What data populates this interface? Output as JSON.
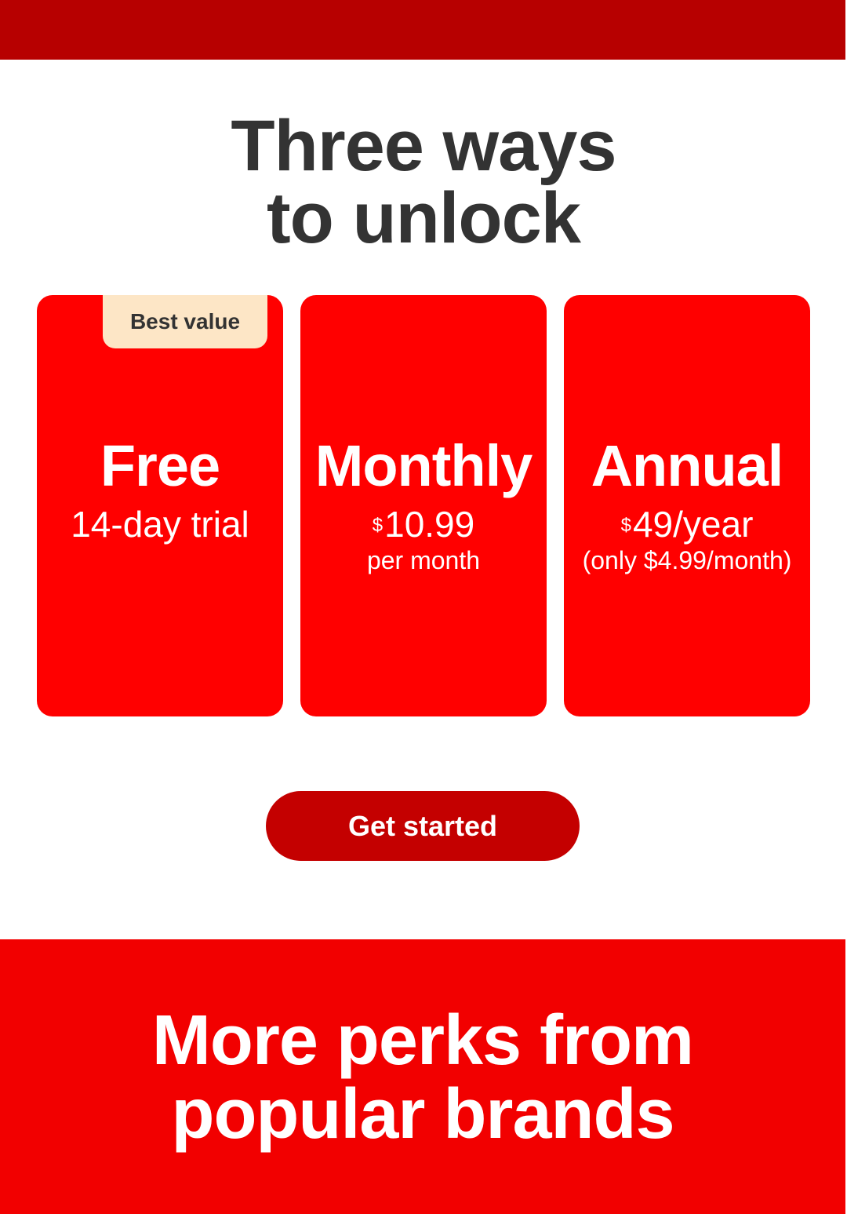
{
  "header": {
    "headline_line1": "Three ways",
    "headline_line2": "to unlock"
  },
  "plans": [
    {
      "badge": "Best value",
      "name": "Free",
      "price_symbol": "",
      "price": "14-day trial",
      "sub": ""
    },
    {
      "badge": "",
      "name": "Monthly",
      "price_symbol": "$",
      "price": "10.99",
      "sub": "per month"
    },
    {
      "badge": "",
      "name": "Annual",
      "price_symbol": "$",
      "price": "49/year",
      "sub": "(only $4.99/month)"
    }
  ],
  "cta": {
    "label": "Get started"
  },
  "perks": {
    "title_line1": "More perks from",
    "title_line2": "popular brands"
  },
  "colors": {
    "top_bar": "#b70000",
    "card": "#ff0000",
    "badge": "#fde6c6",
    "cta": "#c40000",
    "perks_bg": "#f20000",
    "headline_text": "#333333"
  }
}
